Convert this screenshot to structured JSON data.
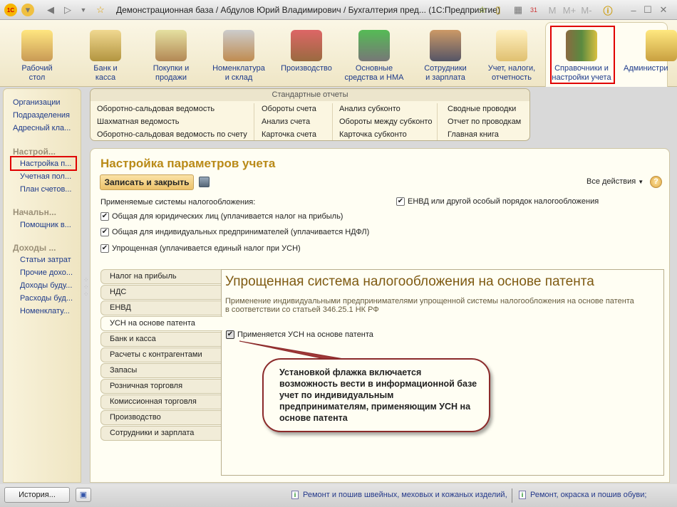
{
  "window": {
    "title": "Демонстрационная база / Абдулов Юрий Владимирович / Бухгалтерия пред...  (1С:Предприятие)",
    "toolbar_mem": [
      "M",
      "M+",
      "M-"
    ]
  },
  "sections": [
    {
      "label": "Рабочий\nстол",
      "icon": "desk-lamp-icon"
    },
    {
      "label": "Банк и\nкасса",
      "icon": "coins-icon"
    },
    {
      "label": "Покупки и\nпродажи",
      "icon": "truck-icon"
    },
    {
      "label": "Номенклатура\nи склад",
      "icon": "shelves-icon"
    },
    {
      "label": "Производство",
      "icon": "toolbox-icon"
    },
    {
      "label": "Основные\nсредства и НМА",
      "icon": "machine-icon"
    },
    {
      "label": "Сотрудники\nи зарплата",
      "icon": "worker-icon"
    },
    {
      "label": "Учет, налоги,\nотчетность",
      "icon": "folder-icon"
    },
    {
      "label": "Справочники и\nнастройки учета",
      "icon": "binders-icon"
    },
    {
      "label": "Администри",
      "icon": "database-icon"
    }
  ],
  "sidebar": {
    "top": [
      "Организации",
      "Подразделения",
      "Адресный кла..."
    ],
    "groups": [
      {
        "title": "Настрой...",
        "items": [
          "Настройка п...",
          "Учетная пол...",
          "План счетов..."
        ]
      },
      {
        "title": "Начальн...",
        "items": [
          "Помощник в..."
        ]
      },
      {
        "title": "Доходы ...",
        "items": [
          "Статьи затрат",
          "Прочие дохо...",
          "Доходы буду...",
          "Расходы буд...",
          "Номенклату..."
        ]
      }
    ]
  },
  "reports": {
    "title": "Стандартные отчеты",
    "columns": [
      [
        "Оборотно-сальдовая ведомость",
        "Шахматная ведомость",
        "Оборотно-сальдовая ведомость по счету"
      ],
      [
        "Обороты счета",
        "Анализ счета",
        "Карточка счета"
      ],
      [
        "Анализ субконто",
        "Обороты между субконто",
        "Карточка субконто"
      ],
      [
        "Сводные проводки",
        "Отчет по проводкам",
        "Главная книга"
      ]
    ]
  },
  "form": {
    "title": "Настройка параметров учета",
    "save_close": "Записать и закрыть",
    "all_actions": "Все действия",
    "help": "?",
    "tax_label": "Применяемые системы налогообложения:",
    "checks": [
      {
        "label": "Общая для юридических лиц (уплачивается налог на прибыль)",
        "checked": true
      },
      {
        "label": "Общая для индивидуальных предпринимателей (уплачивается НДФЛ)",
        "checked": true
      },
      {
        "label": "Упрощенная (уплачивается единый налог при УСН)",
        "checked": true
      },
      {
        "label": "ЕНВД или другой особый порядок налогообложения",
        "checked": true
      }
    ],
    "tabs": [
      "Налог на прибыль",
      "НДС",
      "ЕНВД",
      "УСН на основе патента",
      "Банк и касса",
      "Расчеты с контрагентами",
      "Запасы",
      "Розничная торговля",
      "Комиссионная торговля",
      "Производство",
      "Сотрудники и зарплата"
    ],
    "active_tab": 3,
    "content": {
      "title": "Упрощенная система налогообложения на основе патента",
      "desc1": "Применение индивидуальными предпринимателями упрощенной системы налогообложения на основе патента",
      "desc2": "в соответствии со статьей 346.25.1 НК РФ",
      "patent_check": "Применяется УСН на основе патента"
    }
  },
  "callout": "Установкой флажка включается возможность вести в информационной базе учет по индивидуальным предпринимателям, применяющим УСН на основе патента",
  "status": {
    "history": "История...",
    "items": [
      "Ремонт и пошив швейных, меховых и кожаных изделий,",
      "Ремонт, окраска и пошив обуви;"
    ]
  },
  "colors": {
    "accent": "#b98a18",
    "link": "#1d3a8a",
    "highlight": "#e00000",
    "callout_border": "#8b2a2a"
  }
}
